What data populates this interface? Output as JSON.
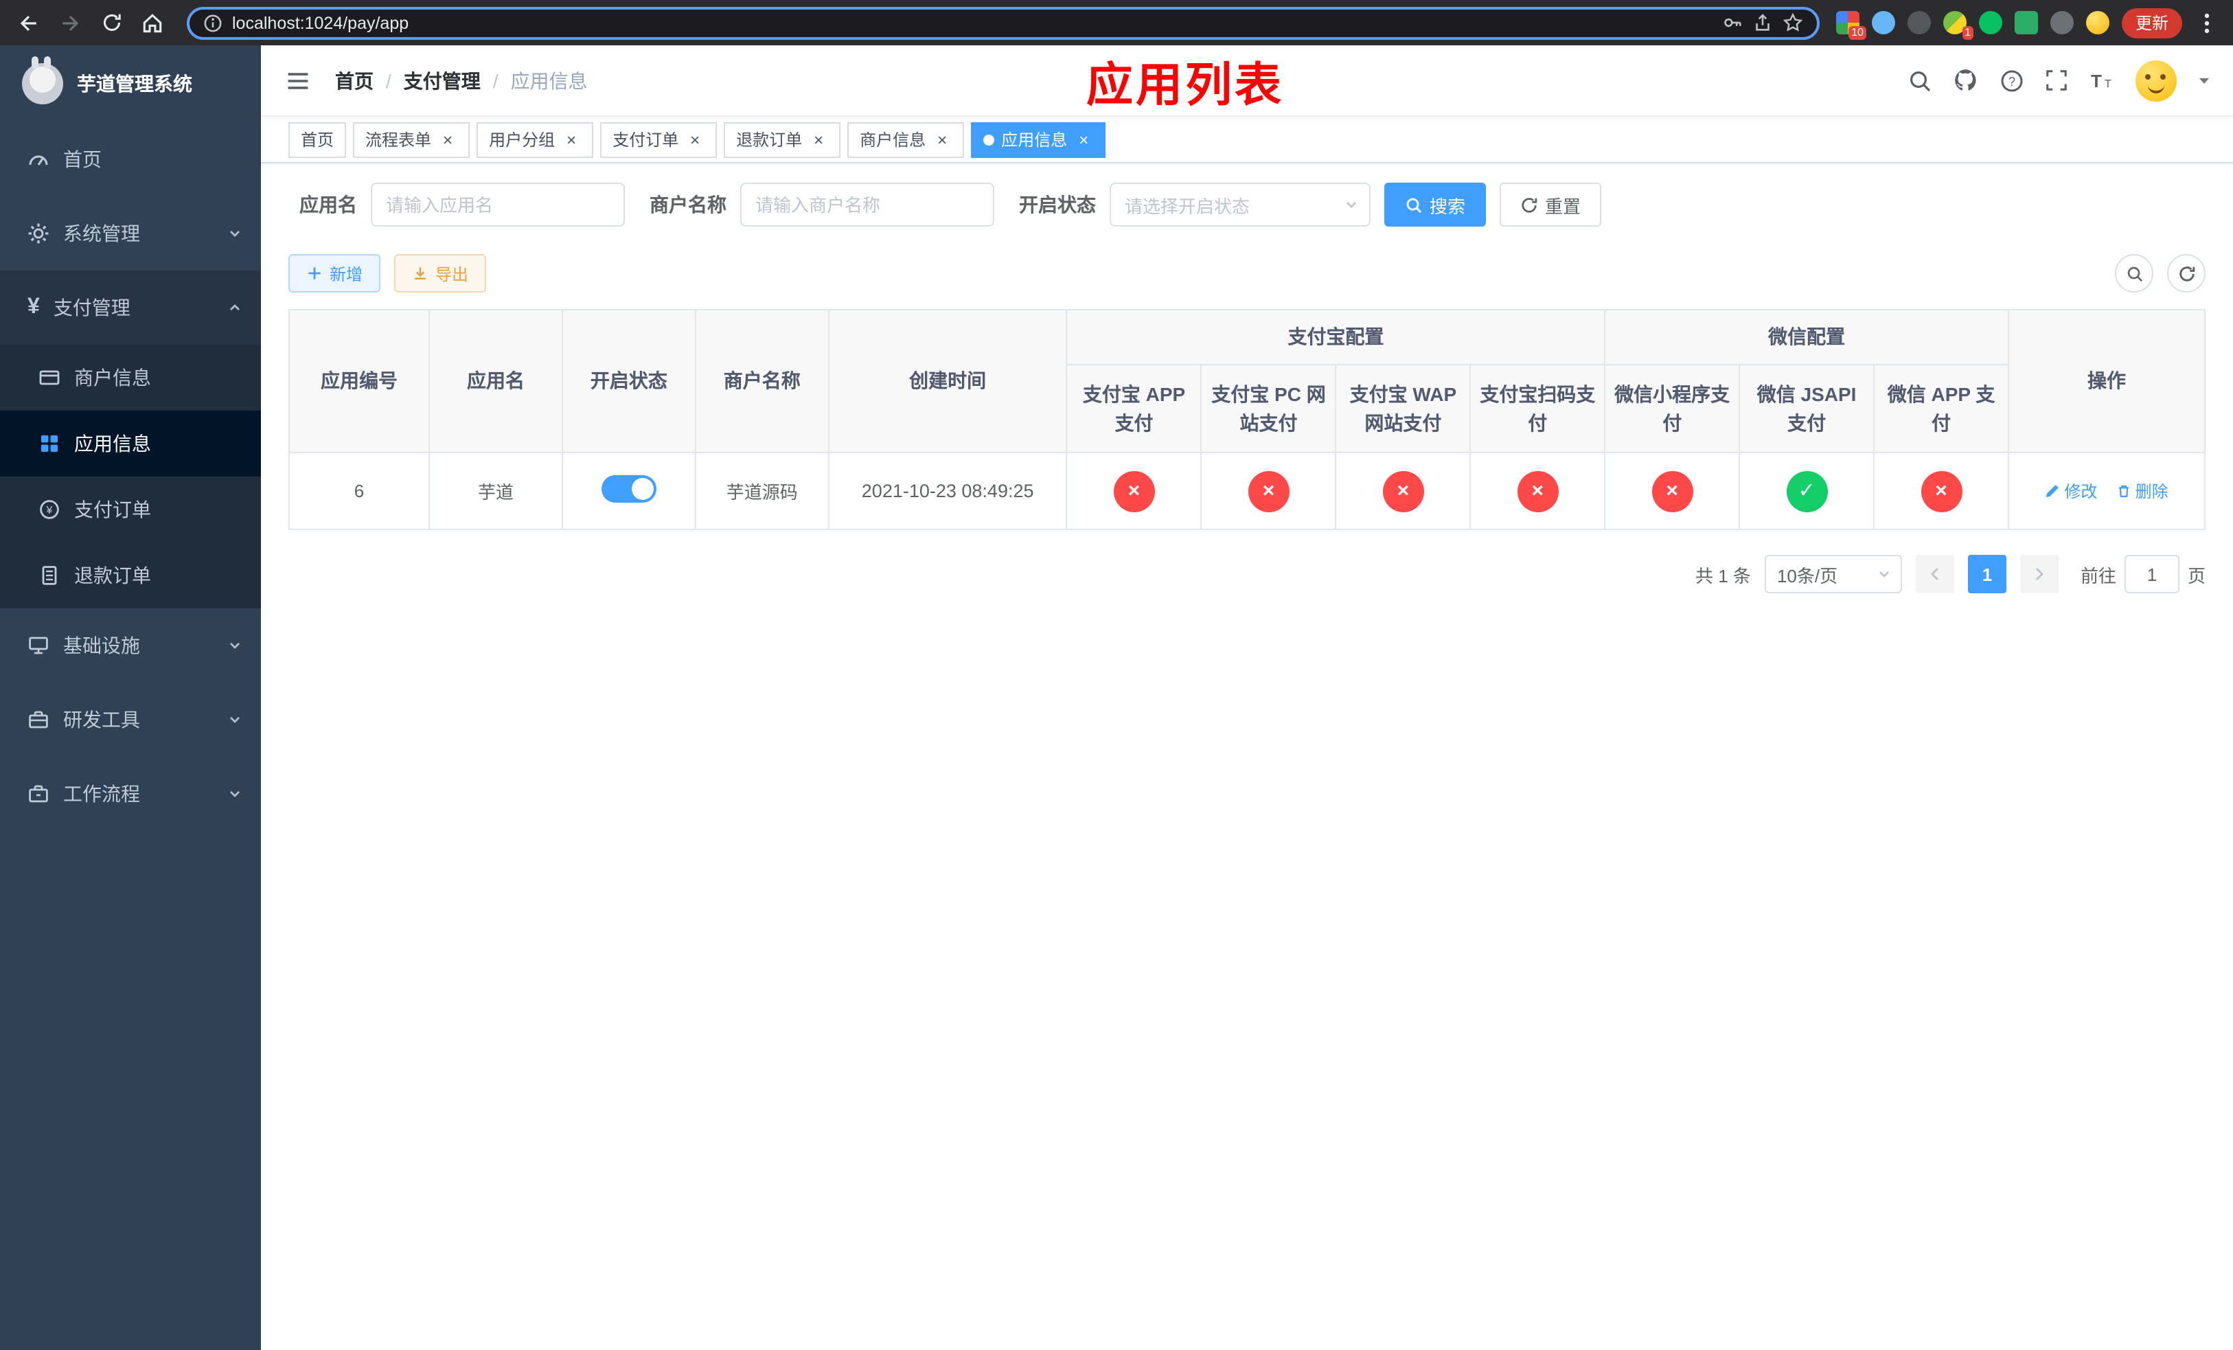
{
  "browser": {
    "url": "localhost:1024/pay/app",
    "update_button": "更新",
    "ext_badge_grid": "10",
    "ext_badge_avatar": "1"
  },
  "sidebar": {
    "app_title": "芋道管理系统",
    "items": [
      {
        "label": "首页"
      },
      {
        "label": "系统管理"
      },
      {
        "label": "支付管理",
        "children": [
          {
            "label": "商户信息"
          },
          {
            "label": "应用信息"
          },
          {
            "label": "支付订单"
          },
          {
            "label": "退款订单"
          }
        ]
      },
      {
        "label": "基础设施"
      },
      {
        "label": "研发工具"
      },
      {
        "label": "工作流程"
      }
    ]
  },
  "header": {
    "breadcrumb": [
      "首页",
      "支付管理",
      "应用信息"
    ],
    "breadcrumb_separator": "/",
    "annotation": "应用列表"
  },
  "tabs": [
    {
      "label": "首页"
    },
    {
      "label": "流程表单"
    },
    {
      "label": "用户分组"
    },
    {
      "label": "支付订单"
    },
    {
      "label": "退款订单"
    },
    {
      "label": "商户信息"
    },
    {
      "label": "应用信息"
    }
  ],
  "filters": {
    "app_name_label": "应用名",
    "app_name_placeholder": "请输入应用名",
    "merchant_label": "商户名称",
    "merchant_placeholder": "请输入商户名称",
    "status_label": "开启状态",
    "status_placeholder": "请选择开启状态",
    "search_button": "搜索",
    "reset_button": "重置"
  },
  "toolbar": {
    "add_button": "新增",
    "export_button": "导出"
  },
  "table": {
    "headers": {
      "app_id": "应用编号",
      "app_name": "应用名",
      "status": "开启状态",
      "merchant_name": "商户名称",
      "create_time": "创建时间",
      "alipay_group": "支付宝配置",
      "wechat_group": "微信配置",
      "actions": "操作",
      "channels": [
        "支付宝 APP 支付",
        "支付宝 PC 网站支付",
        "支付宝 WAP 网站支付",
        "支付宝扫码支付",
        "微信小程序支付",
        "微信 JSAPI 支付",
        "微信 APP 支付"
      ]
    },
    "rows": [
      {
        "app_id": "6",
        "app_name": "芋道",
        "status_on": true,
        "merchant_name": "芋道源码",
        "create_time": "2021-10-23 08:49:25",
        "channels": [
          false,
          false,
          false,
          false,
          false,
          true,
          false
        ],
        "edit_label": "修改",
        "delete_label": "删除"
      }
    ]
  },
  "pagination": {
    "total": "共 1 条",
    "page_size": "10条/页",
    "current_page": "1",
    "goto_label": "前往",
    "goto_value": "1",
    "page_suffix": "页"
  },
  "colors": {
    "primary": "#409eff",
    "success": "#13ce66",
    "danger": "#ff4949",
    "warning": "#e6a23c",
    "annotation": "#ff0000"
  }
}
